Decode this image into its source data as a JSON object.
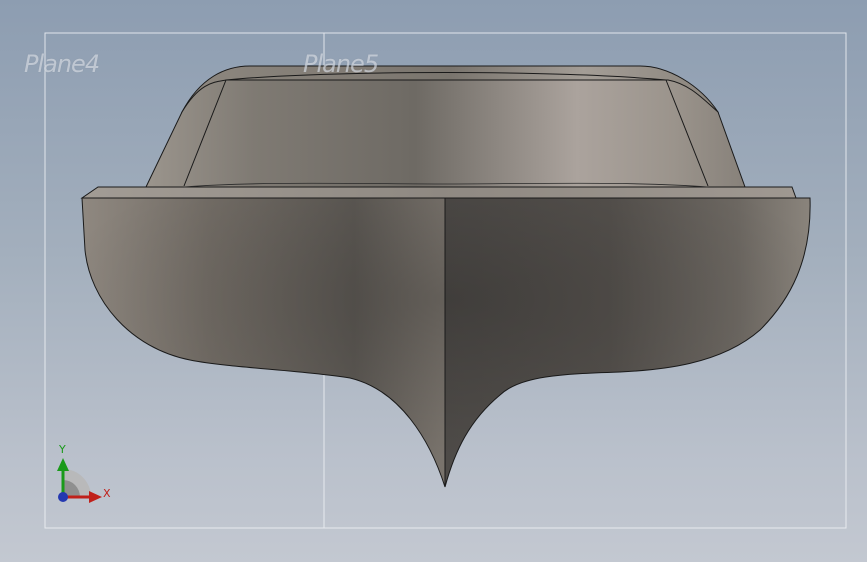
{
  "viewport": {
    "background_top": "#8d9db1",
    "background_bottom": "#c3c8d1"
  },
  "planes": {
    "left_label": "Plane4",
    "center_label": "Plane5",
    "line_color": "#eef1f5"
  },
  "model": {
    "name": "boat-hull",
    "view": "front",
    "hull_color": "#8c857d",
    "edge_color": "#1a1a1a"
  },
  "triad": {
    "y_label": "Y",
    "x_label": "X",
    "y_color": "#1a9a1a",
    "x_color": "#c0201a",
    "z_color": "#2438b0"
  }
}
